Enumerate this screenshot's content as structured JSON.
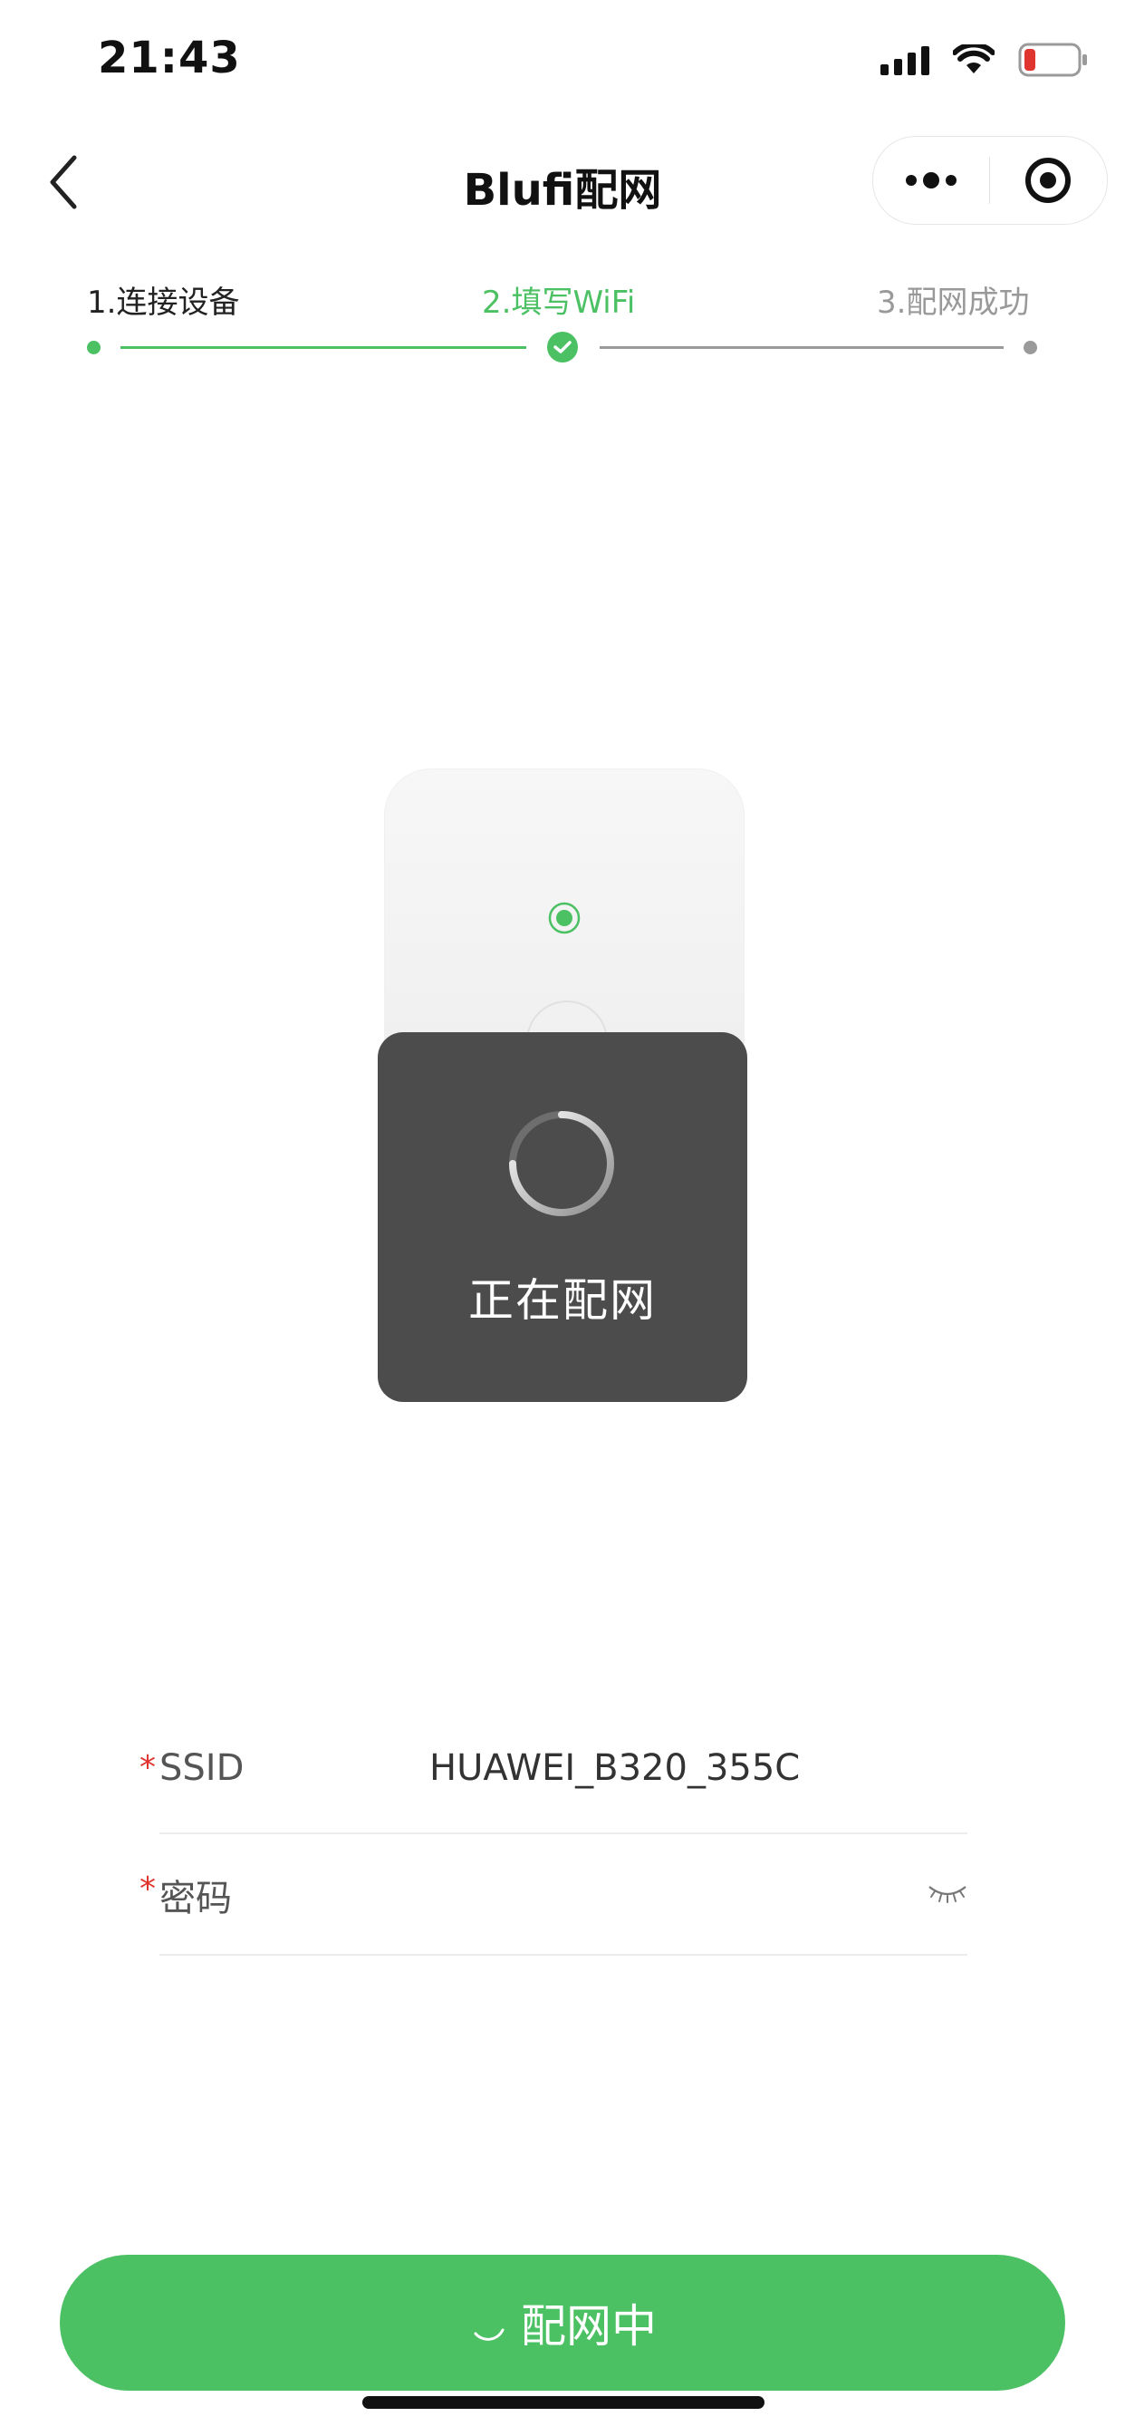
{
  "status_bar": {
    "time": "21:43",
    "signal_icon": "cellular-signal-icon",
    "wifi_icon": "wifi-icon",
    "battery_icon": "battery-low-icon",
    "battery_color": "#e0342e"
  },
  "nav": {
    "title": "Blufi配网",
    "back_icon": "chevron-left-icon",
    "more_icon": "more-dots-icon",
    "close_icon": "target-close-icon"
  },
  "steps": [
    {
      "label": "1.连接设备",
      "state": "done"
    },
    {
      "label": "2.填写WiFi",
      "state": "active"
    },
    {
      "label": "3.配网成功",
      "state": "pending"
    }
  ],
  "colors": {
    "accent": "#4cc164",
    "pending": "#9a9a9a",
    "toast_bg": "#4c4c4c",
    "required": "#e0342e"
  },
  "toast": {
    "text": "正在配网"
  },
  "form": {
    "ssid": {
      "required_mark": "*",
      "label": "SSID",
      "value": "HUAWEI_B320_355C"
    },
    "password": {
      "required_mark": "*",
      "label": "密码",
      "value": "",
      "toggle_icon": "eye-closed-icon"
    }
  },
  "primary_button": {
    "label": "配网中",
    "loading_icon": "loading-spinner-icon"
  }
}
